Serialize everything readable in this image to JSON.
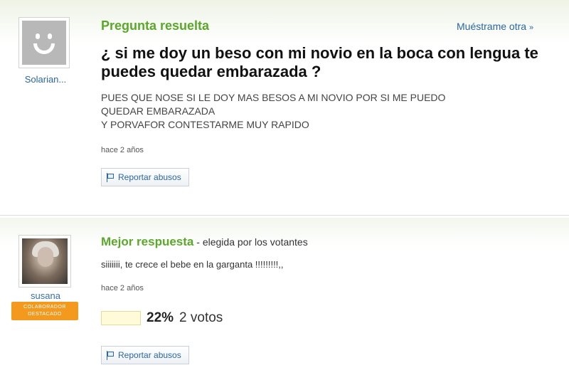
{
  "question": {
    "asker": "Solarian...",
    "status": "Pregunta resuelta",
    "show_more": "Muéstrame otra",
    "title": "¿ si me doy un beso con mi novio en la boca con lengua te puedes quedar embarazada ?",
    "body_lines": [
      "PUES QUE NOSE SI LE DOY MAS BESOS A MI NOVIO POR SI ME PUEDO",
      "QUEDAR EMBARAZADA",
      "Y PORVAFOR CONTESTARME MUY RAPIDO"
    ],
    "time": "hace 2 años",
    "report_label": "Reportar abusos"
  },
  "answer": {
    "answerer": "susana",
    "badge_line1": "COLABORADOR",
    "badge_line2": "DESTACADO",
    "best_label": "Mejor respuesta",
    "chosen_by": " - elegida por los votantes",
    "text": "siiiiiii, te crece el bebe en la garganta !!!!!!!!!,,",
    "time": "hace 2 años",
    "vote_percent": "22%",
    "vote_fraction": 0.22,
    "vote_count": "2 votos",
    "report_label": "Reportar abusos"
  },
  "colors": {
    "accent_green": "#5aa82a",
    "link_blue": "#2a66a8",
    "badge_orange": "#f39a1e"
  },
  "icons": [
    "default-avatar-icon",
    "flag-icon",
    "chevron-right-icon"
  ]
}
